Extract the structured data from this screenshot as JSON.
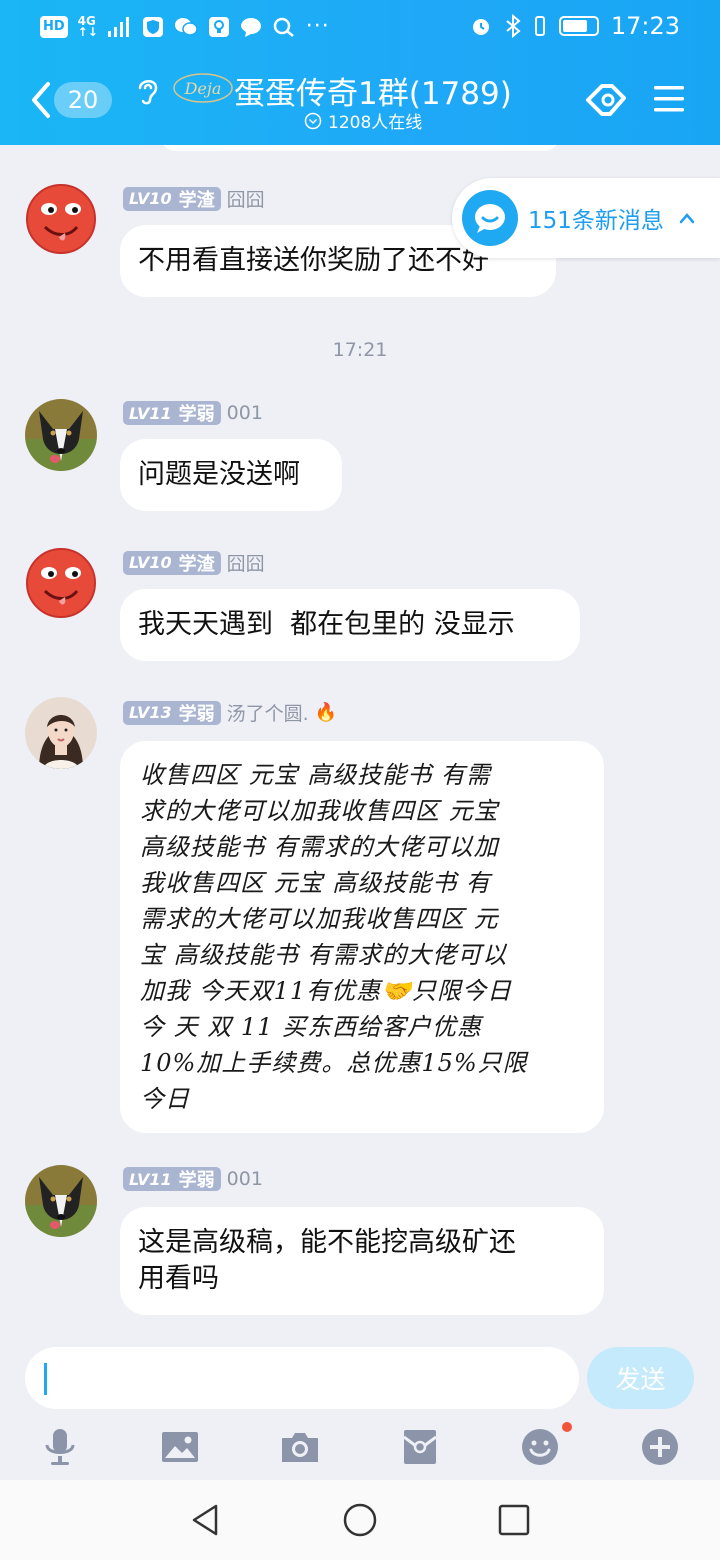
{
  "status_bar": {
    "hd": "HD",
    "net_top": "4G",
    "net_bottom": "↑↓",
    "time": "17:23",
    "battery_level": 0.75
  },
  "header": {
    "unread_count": "20",
    "title": "蛋蛋传奇1群(1789)",
    "online": "1208人在线",
    "badge_text": "Deja"
  },
  "new_messages": {
    "label": "151条新消息"
  },
  "messages": [
    {
      "avatar": "red-emoji-avatar",
      "level": "LV10",
      "rank": "学渣",
      "nick": "囧囧",
      "text": "不用看直接送你奖励了还不好"
    },
    {
      "timestamp": "17:21"
    },
    {
      "avatar": "dog-avatar",
      "level": "LV11",
      "rank": "学弱",
      "nick": "001",
      "text": "问题是没送啊"
    },
    {
      "avatar": "red-emoji-avatar",
      "level": "LV10",
      "rank": "学渣",
      "nick": "囧囧",
      "text": "我天天遇到  都在包里的 没显示"
    },
    {
      "avatar": "woman-avatar",
      "level": "LV13",
      "rank": "学弱",
      "nick": "汤了个圆.",
      "nick_emoji": "🔥",
      "lines": [
        "收售四区 元宝 高级技能书 有需",
        "求的大佬可以加我收售四区 元宝",
        "高级技能书 有需求的大佬可以加",
        "我收售四区 元宝 高级技能书 有",
        "需求的大佬可以加我收售四区 元",
        "宝 高级技能书 有需求的大佬可以",
        "加我 今天双11有优惠🤝只限今日",
        "今 天 双 11 买东西给客户优惠",
        "10%加上手续费。总优惠15%只限",
        "今日"
      ]
    },
    {
      "avatar": "dog-avatar",
      "level": "LV11",
      "rank": "学弱",
      "nick": "001",
      "lines": [
        "这是高级稿，能不能挖高级矿还",
        "用看吗"
      ]
    }
  ],
  "input": {
    "value": "",
    "send_label": "发送"
  },
  "toolbar": [
    "microphone-icon",
    "image-icon",
    "camera-icon",
    "red-packet-icon",
    "emoji-icon",
    "plus-icon"
  ],
  "colors": {
    "header": "#1fa8f7",
    "accent": "#1e9ef0",
    "background": "#eef0f6",
    "send_disabled": "#c5eafc",
    "badge_red": "#f2543b"
  }
}
